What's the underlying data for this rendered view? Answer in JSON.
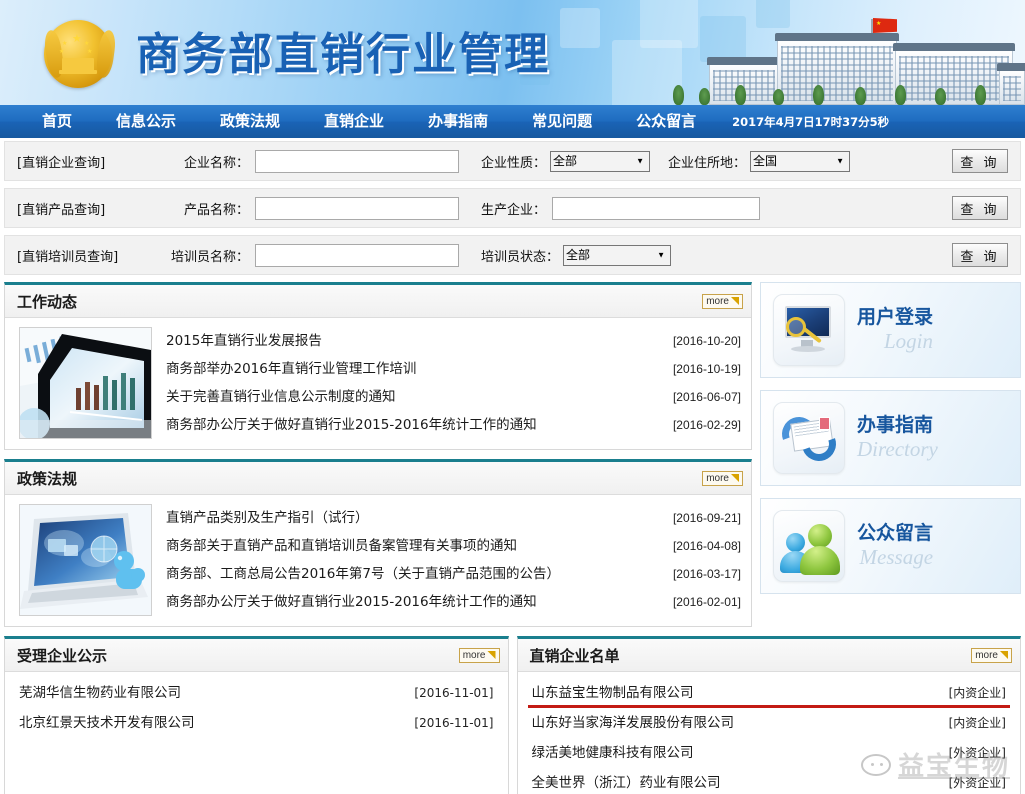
{
  "header": {
    "title": "商务部直销行业管理",
    "emblem_alt": "national-emblem",
    "building_alt": "ministry-building"
  },
  "nav": {
    "items": [
      {
        "label": "首页",
        "name": "nav-home"
      },
      {
        "label": "信息公示",
        "name": "nav-information-disclosure"
      },
      {
        "label": "政策法规",
        "name": "nav-policy-regulations"
      },
      {
        "label": "直销企业",
        "name": "nav-direct-selling-enterprises"
      },
      {
        "label": "办事指南",
        "name": "nav-service-guide"
      },
      {
        "label": "常见问题",
        "name": "nav-faq"
      },
      {
        "label": "公众留言",
        "name": "nav-public-message"
      }
    ],
    "clock": "2017年4月7日17时37分5秒"
  },
  "search": {
    "rows": [
      {
        "tag": "[直销企业查询]",
        "label1": "企业名称：",
        "value1": "",
        "label2": "企业性质：",
        "select2": "全部",
        "label3": "企业住所地：",
        "select3": "全国",
        "button": "查 询"
      },
      {
        "tag": "[直销产品查询]",
        "label1": "产品名称：",
        "value1": "",
        "label2": "生产企业：",
        "value2": "",
        "button": "查 询"
      },
      {
        "tag": "[直销培训员查询]",
        "label1": "培训员名称：",
        "value1": "",
        "label2": "培训员状态：",
        "select2": "全部",
        "button": "查 询"
      }
    ],
    "options_nature": [
      "全部",
      "内资企业",
      "外资企业"
    ],
    "options_region": [
      "全国"
    ],
    "options_trainer_status": [
      "全部"
    ]
  },
  "panels": {
    "work_news": {
      "title": "工作动态",
      "more": "more",
      "thumb_alt": "tablet-chart-photo",
      "items": [
        {
          "title": "2015年直销行业发展报告",
          "date": "[2016-10-20]"
        },
        {
          "title": "商务部举办2016年直销行业管理工作培训",
          "date": "[2016-10-19]"
        },
        {
          "title": "关于完善直销行业信息公示制度的通知",
          "date": "[2016-06-07]"
        },
        {
          "title": "商务部办公厅关于做好直销行业2015-2016年统计工作的通知",
          "date": "[2016-02-29]"
        }
      ]
    },
    "policy": {
      "title": "政策法规",
      "more": "more",
      "thumb_alt": "laptop-globe-photo",
      "items": [
        {
          "title": "直销产品类别及生产指引（试行）",
          "date": "[2016-09-21]"
        },
        {
          "title": "商务部关于直销产品和直销培训员备案管理有关事项的通知",
          "date": "[2016-04-08]"
        },
        {
          "title": "商务部、工商总局公告2016年第7号（关于直销产品范围的公告）",
          "date": "[2016-03-17]"
        },
        {
          "title": "商务部办公厅关于做好直销行业2015-2016年统计工作的通知",
          "date": "[2016-02-01]"
        }
      ]
    },
    "accepted": {
      "title": "受理企业公示",
      "more": "more",
      "items": [
        {
          "name": "芜湖华信生物药业有限公司",
          "meta": "[2016-11-01]"
        },
        {
          "name": "北京红景天技术开发有限公司",
          "meta": "[2016-11-01]"
        }
      ]
    },
    "enterprise_list": {
      "title": "直销企业名单",
      "more": "more",
      "items": [
        {
          "name": "山东益宝生物制品有限公司",
          "meta": "[内资企业]",
          "highlighted": true
        },
        {
          "name": "山东好当家海洋发展股份有限公司",
          "meta": "[内资企业]",
          "highlighted": false
        },
        {
          "name": "绿活美地健康科技有限公司",
          "meta": "[外资企业]",
          "highlighted": false
        },
        {
          "name": "全美世界（浙江）药业有限公司",
          "meta": "[外资企业]",
          "highlighted": false
        }
      ]
    }
  },
  "side_boxes": [
    {
      "cn": "用户登录",
      "en": "Login",
      "icon": "monitor-magnifier-icon"
    },
    {
      "cn": "办事指南",
      "en": "Directory",
      "icon": "envelope-arrows-icon"
    },
    {
      "cn": "公众留言",
      "en": "Message",
      "icon": "two-people-icon"
    }
  ],
  "watermark": {
    "text": "益宝生物"
  },
  "colors": {
    "nav_blue": "#1f6cc0",
    "panel_top_teal": "#1a7f8e",
    "title_blue": "#1961b4",
    "highlight_red": "#c31b14",
    "side_label_blue": "#17569e"
  }
}
